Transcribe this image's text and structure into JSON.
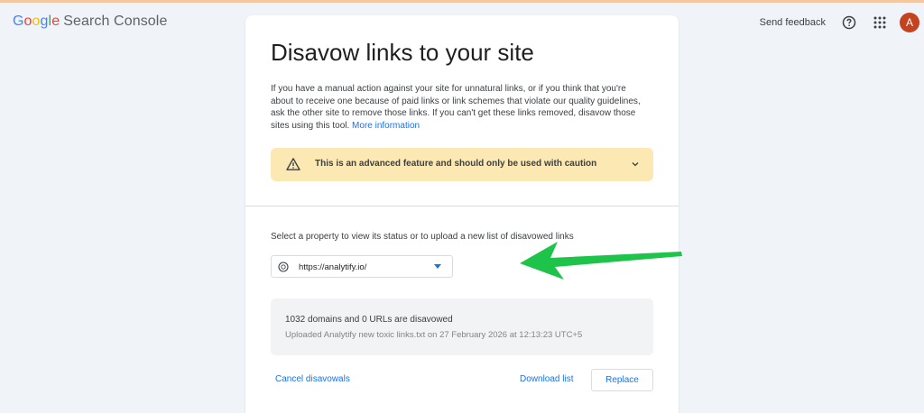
{
  "header": {
    "logo_letters": [
      "G",
      "o",
      "o",
      "g",
      "l",
      "e"
    ],
    "product_name": "Search Console",
    "send_feedback": "Send feedback",
    "avatar_letter": "A",
    "icons": [
      "help-icon",
      "apps-icon"
    ]
  },
  "page": {
    "title": "Disavow links to your site",
    "description": "If you have a manual action against your site for unnatural links, or if you think that you're about to receive one because of paid links or link schemes that violate our quality guidelines, ask the other site to remove those links. If you can't get these links removed, disavow those sites using this tool.",
    "more_info_link": "More information",
    "caution_text": "This is an advanced feature and should only be used with caution",
    "select_label": "Select a property to view its status or to upload a new list of disavowed links",
    "property_value": "https://analytify.io/",
    "status_main": "1032 domains and 0 URLs are disavowed",
    "status_sub": "Uploaded Analytify new toxic links.txt on 27 February 2026 at 12:13:23 UTC+5",
    "cancel_label": "Cancel disavowals",
    "download_label": "Download list",
    "replace_label": "Replace"
  },
  "colors": {
    "background": "#f0f4f9",
    "accent_blue": "#1a73e8",
    "caution_bg": "#fce8b2",
    "avatar_bg": "#c5421f",
    "annotation_arrow": "#1ec34a"
  }
}
